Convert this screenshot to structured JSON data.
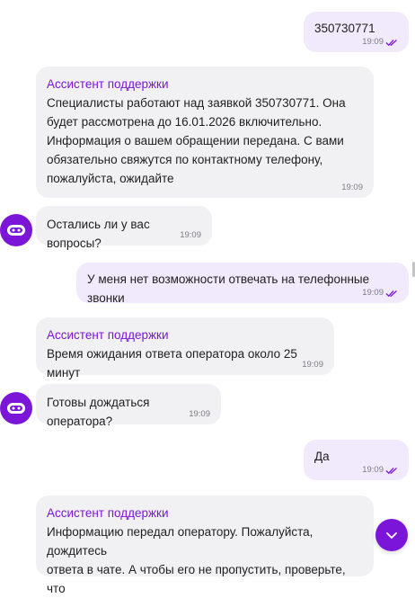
{
  "messages": {
    "m1": {
      "text": "350730771",
      "time": "19:09"
    },
    "m2": {
      "sender": "Ассистент поддержки",
      "line1": "Специалисты работают над заявкой 350730771. Она",
      "line2": "будет рассмотрена до 16.01.2026 включительно.",
      "line3": "Информация о вашем обращении передана. С вами",
      "line4": "обязательно свяжутся по контактному телефону,",
      "line5": "пожалуйста, ожидайте",
      "time": "19:09"
    },
    "m3": {
      "text": "Остались ли у вас вопросы?",
      "time": "19:09"
    },
    "m4": {
      "text": "У меня нет возможности отвечать на телефонные звонки",
      "time": "19:09"
    },
    "m5": {
      "sender": "Ассистент поддержки",
      "text": "Время ожидания ответа оператора около 25 минут",
      "time": "19:09"
    },
    "m6": {
      "text": "Готовы дождаться оператора?",
      "time": "19:09"
    },
    "m7": {
      "text": "Да",
      "time": "19:09"
    },
    "m8": {
      "sender": "Ассистент поддержки",
      "line1": "Информацию передал оператору. Пожалуйста, дождитесь",
      "line2": "ответа в чате. А чтобы его не пропустить, проверьте, что"
    }
  },
  "icons": {
    "bot_avatar": "robot-face-icon",
    "read_receipt": "double-check-icon",
    "scroll_down": "chevron-down-icon"
  },
  "colors": {
    "accent": "#7b16d9",
    "outgoing_bubble": "#f1e9fc",
    "incoming_bubble": "#f1f1f3",
    "read_check": "#7b16d9"
  }
}
